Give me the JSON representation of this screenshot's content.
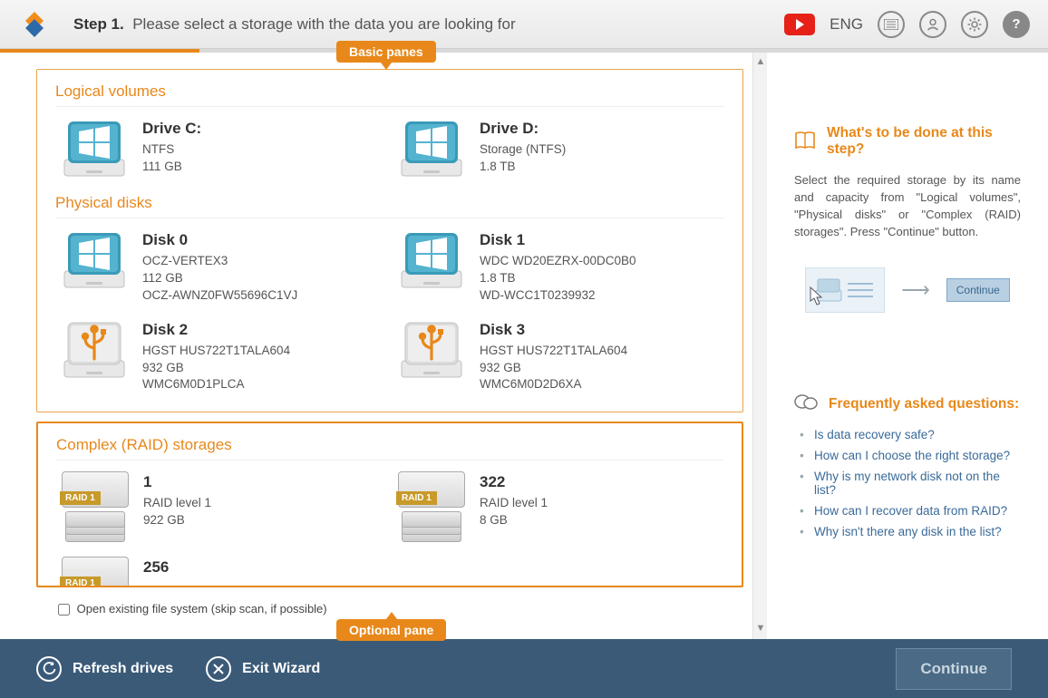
{
  "header": {
    "step_label": "Step 1.",
    "step_text": "Please select a storage with the data you are looking for",
    "lang": "ENG"
  },
  "badges": {
    "basic": "Basic panes",
    "optional": "Optional pane"
  },
  "sections": {
    "logical": {
      "title": "Logical volumes",
      "items": [
        {
          "title": "Drive C:",
          "line1": "NTFS",
          "line2": "111 GB",
          "line3": ""
        },
        {
          "title": "Drive D:",
          "line1": "Storage (NTFS)",
          "line2": "1.8 TB",
          "line3": ""
        }
      ]
    },
    "physical": {
      "title": "Physical disks",
      "items": [
        {
          "title": "Disk 0",
          "line1": "OCZ-VERTEX3",
          "line2": "112 GB",
          "line3": "OCZ-AWNZ0FW55696C1VJ",
          "icon": "win"
        },
        {
          "title": "Disk 1",
          "line1": "WDC WD20EZRX-00DC0B0",
          "line2": "1.8 TB",
          "line3": "WD-WCC1T0239932",
          "icon": "win"
        },
        {
          "title": "Disk 2",
          "line1": "HGST HUS722T1TALA604",
          "line2": "932 GB",
          "line3": "WMC6M0D1PLCA",
          "icon": "usb"
        },
        {
          "title": "Disk 3",
          "line1": "HGST HUS722T1TALA604",
          "line2": "932 GB",
          "line3": "WMC6M0D2D6XA",
          "icon": "usb"
        }
      ]
    },
    "raid": {
      "title": "Complex (RAID) storages",
      "items": [
        {
          "title": "1",
          "line1": "RAID level 1",
          "line2": "922 GB",
          "raid_label": "RAID 1"
        },
        {
          "title": "322",
          "line1": "RAID level 1",
          "line2": "8 GB",
          "raid_label": "RAID 1"
        },
        {
          "title": "256",
          "line1": "",
          "line2": "",
          "raid_label": "RAID 1"
        }
      ]
    }
  },
  "checkbox": {
    "label": "Open existing file system (skip scan, if possible)"
  },
  "sidebar": {
    "whats_title": "What's to be done at this step?",
    "whats_text": "Select the required storage by its name and capacity from \"Logical volumes\", \"Physical disks\" or \"Complex (RAID) storages\". Press \"Continue\" button.",
    "diagram_btn": "Continue",
    "faq_title": "Frequently asked questions:",
    "faq": [
      "Is data recovery safe?",
      "How can I choose the right storage?",
      "Why is my network disk not on the list?",
      "How can I recover data from RAID?",
      "Why isn't there any disk in the list?"
    ]
  },
  "footer": {
    "refresh": "Refresh drives",
    "exit": "Exit Wizard",
    "continue": "Continue"
  }
}
